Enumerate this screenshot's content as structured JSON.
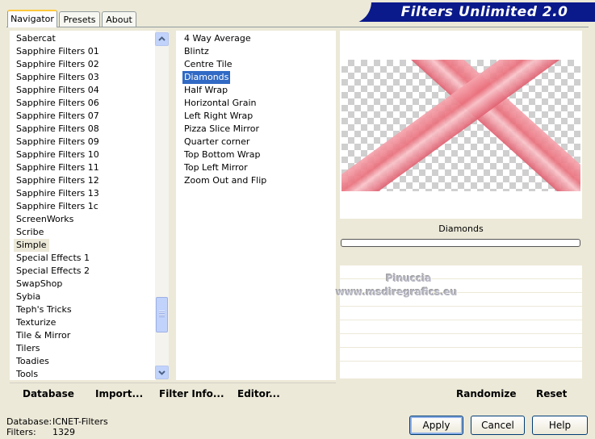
{
  "tabs": [
    {
      "label": "Navigator",
      "active": true
    },
    {
      "label": "Presets",
      "active": false
    },
    {
      "label": "About",
      "active": false
    }
  ],
  "banner": {
    "title": "Filters Unlimited 2.0"
  },
  "categories": [
    "Sabercat",
    "Sapphire Filters 01",
    "Sapphire Filters 02",
    "Sapphire Filters 03",
    "Sapphire Filters 04",
    "Sapphire Filters 06",
    "Sapphire Filters 07",
    "Sapphire Filters 08",
    "Sapphire Filters 09",
    "Sapphire Filters 10",
    "Sapphire Filters 11",
    "Sapphire Filters 12",
    "Sapphire Filters 13",
    "Sapphire Filters 1c",
    "ScreenWorks",
    "Scribe",
    "Simple",
    "Special Effects 1",
    "Special Effects 2",
    "SwapShop",
    "Sybia",
    "Teph's Tricks",
    "Texturize",
    "Tile & Mirror",
    "Tilers",
    "Toadies",
    "Tools"
  ],
  "selected_category": "Simple",
  "filters": [
    "4 Way Average",
    "Blintz",
    "Centre Tile",
    "Diamonds",
    "Half Wrap",
    "Horizontal Grain",
    "Left Right Wrap",
    "Pizza Slice Mirror",
    "Quarter corner",
    "Top Bottom Wrap",
    "Top Left Mirror",
    "Zoom Out and Flip"
  ],
  "selected_filter": "Diamonds",
  "preview": {
    "filter_name": "Diamonds"
  },
  "watermark": {
    "line1": "Pinuccia",
    "line2": "www.msdiregrafics.eu"
  },
  "left_toolbar": {
    "database": "Database",
    "import": "Import...",
    "filter_info": "Filter Info...",
    "editor": "Editor..."
  },
  "right_toolbar": {
    "randomize": "Randomize",
    "reset": "Reset"
  },
  "status": {
    "database_label": "Database:",
    "database_value": "ICNET-Filters",
    "filters_label": "Filters:",
    "filters_value": "1329"
  },
  "buttons": {
    "apply": "Apply",
    "cancel": "Cancel",
    "help": "Help"
  },
  "colors": {
    "banner": "#0a1a8a",
    "selection": "#316ac5",
    "window": "#ece9d8"
  }
}
